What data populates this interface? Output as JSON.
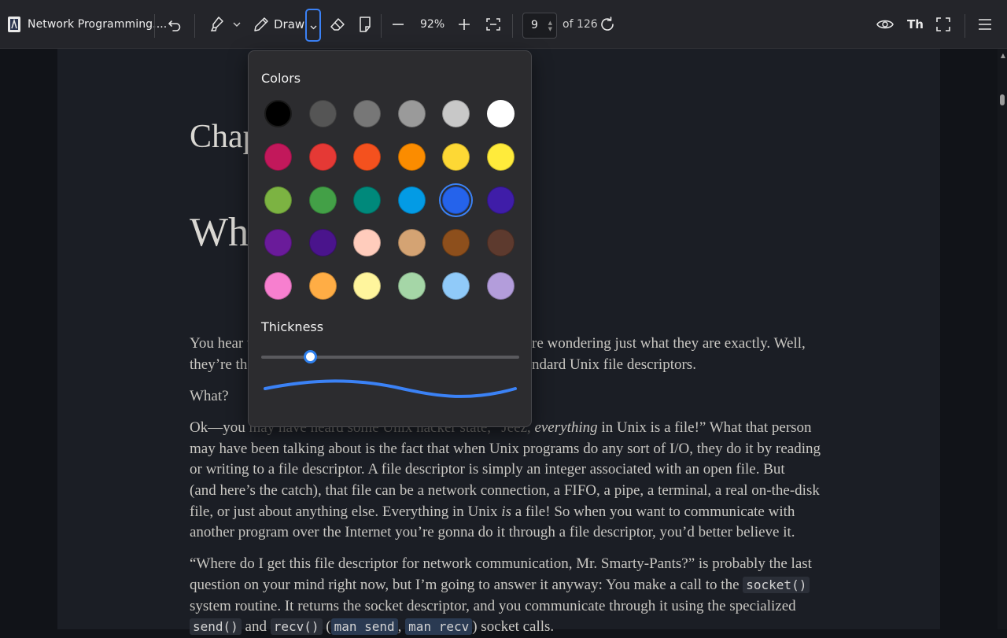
{
  "toolbar": {
    "doc_title": "Network Programming....",
    "draw_label": "Draw",
    "zoom": "92%",
    "page_current": "9",
    "page_total": "of 126",
    "text_mode_label": "Th"
  },
  "doc": {
    "chapter_partial": "Chap",
    "heading_partial": "Wh",
    "p1_l1_left": "You hear t",
    "p1_l1_right": "re wondering just what they are exactly. Well,",
    "p1_l2_left": "they’re th",
    "p1_l2_right": "ndard Unix file descriptors.",
    "what": "What?",
    "p2_l1_a": "Ok—you ",
    "p2_l1_b": "may have heard some Unix hacker state, “Jeez,",
    "p2_l1_em": " everything",
    "p2_l1_c": " in Unix is a file!” What that person",
    "p2_l2": "may have been talking about is the fact that when Unix programs do any sort of I/O, they do it by reading",
    "p2_l3": "or writing to a file descriptor. A file descriptor is simply an integer associated with an open file. But",
    "p2_l4": "(and here’s the catch), that file can be a network connection, a FIFO, a pipe, a terminal, a real on-the-disk",
    "p2_l5_a": "file, or just about anything else. Everything in Unix ",
    "p2_l5_em": "is",
    "p2_l5_b": " a file! So when you want to communicate with",
    "p2_l6": "another program over the Internet you’re gonna do it through a file descriptor, you’d better believe it.",
    "p3_l1": "“Where do I get this file descriptor for network communication, Mr. Smarty-Pants?” is probably the last",
    "p3_l2": "question on your mind right now, but I’m going to answer it anyway: You make a call to the ",
    "p3_code_socket": "socket()",
    "p3_l3": "system routine. It returns the socket descriptor, and you communicate through it using the specialized",
    "p3_code_send": "send()",
    "p3_and": " and ",
    "p3_code_recv": "recv()",
    "p3_paren": " (",
    "p3_code_man_send": "man send",
    "p3_comma": ", ",
    "p3_code_man_recv": "man recv",
    "p3_tail": ") socket calls."
  },
  "popup": {
    "colors_title": "Colors",
    "thickness_title": "Thickness",
    "thickness_value": 0.19,
    "selected_color": "#2563eb",
    "colors": [
      [
        "#000000",
        "#555555",
        "#777777",
        "#9a9a9a",
        "#c8c8c8",
        "#ffffff"
      ],
      [
        "#c2185b",
        "#e53935",
        "#f4511e",
        "#fb8c00",
        "#fdd835",
        "#ffeb3b"
      ],
      [
        "#7cb342",
        "#43a047",
        "#00897b",
        "#039be5",
        "#2563eb",
        "#3f1da8"
      ],
      [
        "#6a1b9a",
        "#4a148c",
        "#ffccbc",
        "#d4a373",
        "#8d4f1c",
        "#5d3a2e"
      ],
      [
        "#f77fcf",
        "#ffad45",
        "#fff59d",
        "#a5d6a7",
        "#90caf9",
        "#b39ddb"
      ]
    ]
  },
  "icons": [
    "book-icon",
    "undo-icon",
    "highlighter-icon",
    "chevron-down-icon",
    "pen-icon",
    "eraser-icon",
    "page-icon",
    "zoom-out-icon",
    "zoom-in-icon",
    "fit-page-icon",
    "rotate-icon",
    "eye-icon",
    "fullscreen-icon",
    "menu-icon"
  ]
}
